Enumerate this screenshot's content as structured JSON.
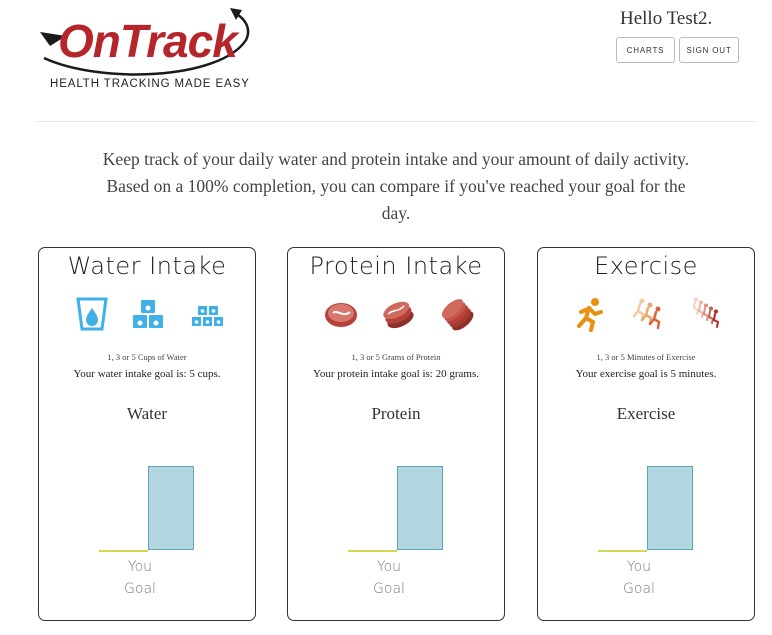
{
  "header": {
    "logo_text": "OnTrack",
    "tagline": "HEALTH TRACKING MADE EASY",
    "greeting": "Hello Test2.",
    "buttons": {
      "charts": "CHARTS",
      "sign_out": "SIGN OUT"
    }
  },
  "intro": "Keep track of your daily water and protein intake and your amount of daily activity. Based on a 100% completion, you can compare if you've reached your goal for the day.",
  "cards": {
    "water": {
      "title": "Water Intake",
      "icons": [
        "cup-1-icon",
        "cups-3-icon",
        "cups-5-icon"
      ],
      "options": "1, 3 or 5 Cups of Water",
      "goal_text": "Your water intake goal is: 5 cups.",
      "chart_title": "Water",
      "you_label": "You",
      "goal_label": "Goal",
      "progress_fraction": 0,
      "goal_fraction": 1
    },
    "protein": {
      "title": "Protein Intake",
      "icons": [
        "steak-1-icon",
        "steak-3-icon",
        "steak-5-icon"
      ],
      "options": "1, 3 or 5 Grams of Protein",
      "goal_text": "Your protein intake goal is: 20 grams.",
      "chart_title": "Protein",
      "you_label": "You",
      "goal_label": "Goal",
      "progress_fraction": 0,
      "goal_fraction": 1
    },
    "exercise": {
      "title": "Exercise",
      "icons": [
        "runner-1-icon",
        "runner-3-icon",
        "runner-5-icon"
      ],
      "options": "1, 3 or 5 Minutes of Exercise",
      "goal_text": "Your exercise goal is 5 minutes.",
      "chart_title": "Exercise",
      "you_label": "You",
      "goal_label": "Goal",
      "progress_fraction": 0,
      "goal_fraction": 1
    }
  },
  "colors": {
    "brand_red": "#b5262b",
    "water_blue": "#3fb0e8",
    "steak_red": "#b5413a",
    "runner_orange": "#e8900f",
    "goal_bar": "#b3d7e0",
    "you_baseline": "#d4d84e"
  }
}
